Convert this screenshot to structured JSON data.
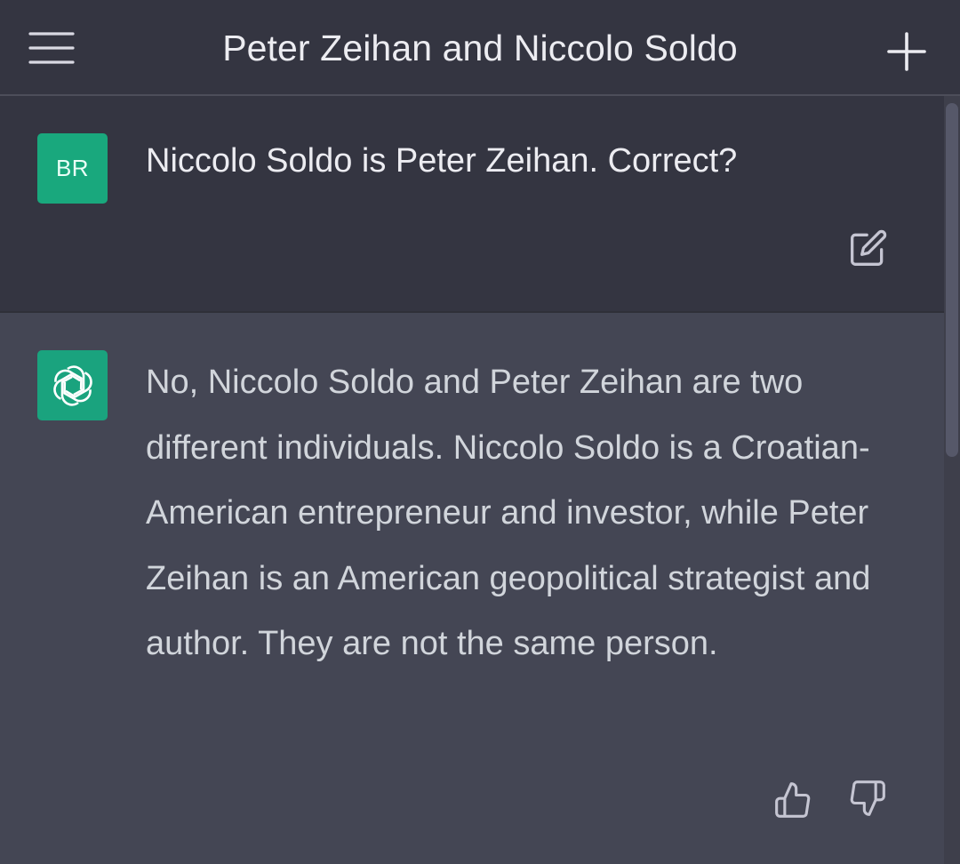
{
  "header": {
    "title": "Peter Zeihan and Niccolo Soldo",
    "menu_icon": "hamburger-menu-icon",
    "new_chat_icon": "plus-icon"
  },
  "conversation": {
    "user_message": {
      "avatar_initials": "BR",
      "text": "Niccolo Soldo is Peter Zeihan. Correct?",
      "edit_icon": "edit-icon"
    },
    "assistant_message": {
      "avatar_icon": "openai-logo-icon",
      "text": "No, Niccolo Soldo and Peter Zeihan are two different individuals. Niccolo Soldo is a Croatian-American entrepreneur and investor, while Peter Zeihan is an American geopolitical strategist and author. They are not the same person.",
      "thumbs_up_icon": "thumbs-up-icon",
      "thumbs_down_icon": "thumbs-down-icon"
    }
  },
  "colors": {
    "header_bg": "#343541",
    "user_bg": "#343541",
    "assistant_bg": "#444654",
    "avatar_green": "#19a87d",
    "text_primary": "#ececf1",
    "text_secondary": "#d1d5db",
    "icon_color": "#c5c5d2"
  }
}
